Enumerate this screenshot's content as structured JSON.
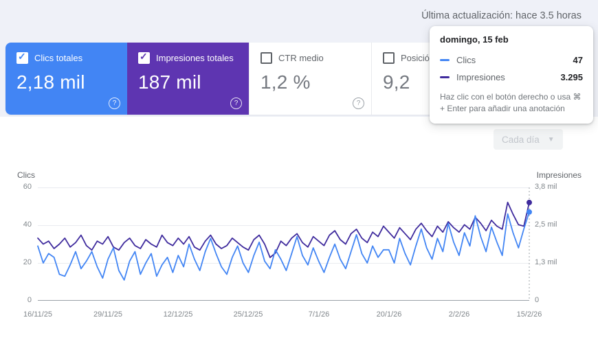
{
  "header": {
    "last_update": "Última actualización: hace 3.5 horas"
  },
  "cards": [
    {
      "label": "Clics totales",
      "value": "2,18 mil",
      "checked": true,
      "color": "#4285f4",
      "help": "?"
    },
    {
      "label": "Impresiones totales",
      "value": "187 mil",
      "checked": true,
      "color": "#5e35b1",
      "help": "?"
    },
    {
      "label": "CTR medio",
      "value": "1,2 %",
      "checked": false,
      "help": "?"
    },
    {
      "label": "Posición media",
      "value": "9,2",
      "checked": false,
      "help": "?"
    }
  ],
  "granularity": {
    "label": "Cada día"
  },
  "tooltip": {
    "date": "domingo, 15 feb",
    "rows": [
      {
        "label": "Clics",
        "value": "47",
        "color": "#4285f4"
      },
      {
        "label": "Impresiones",
        "value": "3.295",
        "color": "#3f2b9d"
      }
    ],
    "hint": "Haz clic con el botón derecho o usa ⌘ + Enter para añadir una anotación"
  },
  "chart_data": {
    "type": "line",
    "x_ticks": [
      "16/11/25",
      "29/11/25",
      "12/12/25",
      "25/12/25",
      "7/1/26",
      "20/1/26",
      "2/2/26",
      "15/2/26"
    ],
    "left_axis": {
      "title": "Clics",
      "ticks": [
        "60",
        "40",
        "20",
        "0"
      ],
      "max": 60
    },
    "right_axis": {
      "title": "Impresiones",
      "ticks": [
        "3,8 mil",
        "2,5 mil",
        "1,3 mil",
        "0"
      ],
      "max": 3800
    },
    "grid": true,
    "legend_position": "tooltip",
    "highlight_index": 91,
    "series": [
      {
        "name": "Clics",
        "axis": "left",
        "max": 60,
        "color": "#4285f4",
        "values": [
          29,
          20,
          25,
          23,
          14,
          13,
          19,
          26,
          17,
          21,
          26,
          18,
          12,
          22,
          28,
          16,
          11,
          21,
          26,
          14,
          20,
          25,
          13,
          19,
          23,
          15,
          24,
          18,
          30,
          22,
          16,
          26,
          33,
          25,
          18,
          14,
          23,
          29,
          20,
          15,
          24,
          31,
          21,
          17,
          27,
          22,
          16,
          25,
          34,
          24,
          19,
          28,
          21,
          15,
          23,
          30,
          22,
          17,
          26,
          35,
          25,
          20,
          29,
          23,
          27,
          27,
          20,
          33,
          25,
          19,
          29,
          38,
          28,
          22,
          33,
          26,
          41,
          31,
          24,
          36,
          29,
          45,
          34,
          26,
          39,
          31,
          24,
          46,
          36,
          28,
          38,
          47
        ]
      },
      {
        "name": "Impresiones",
        "axis": "right",
        "max": 3800,
        "color": "#3f2b9d",
        "values": [
          2100,
          1900,
          2000,
          1750,
          1900,
          2100,
          1800,
          1950,
          2200,
          1850,
          1700,
          2000,
          1900,
          2150,
          1800,
          1700,
          1950,
          2100,
          1850,
          1750,
          2050,
          1900,
          1800,
          2200,
          1950,
          1850,
          2100,
          1900,
          2150,
          1800,
          1700,
          2000,
          2200,
          1900,
          1750,
          1850,
          2100,
          1950,
          1800,
          1700,
          2050,
          2200,
          1900,
          1450,
          1600,
          2000,
          1850,
          2100,
          2250,
          1950,
          1800,
          2150,
          2000,
          1850,
          2200,
          2350,
          2050,
          1900,
          2250,
          2400,
          2100,
          1950,
          2300,
          2150,
          2500,
          2300,
          2100,
          2450,
          2250,
          2050,
          2400,
          2600,
          2350,
          2150,
          2500,
          2300,
          2650,
          2450,
          2300,
          2550,
          2400,
          2800,
          2600,
          2350,
          2700,
          2500,
          2400,
          3300,
          2900,
          2550,
          2500,
          3295
        ]
      }
    ]
  }
}
